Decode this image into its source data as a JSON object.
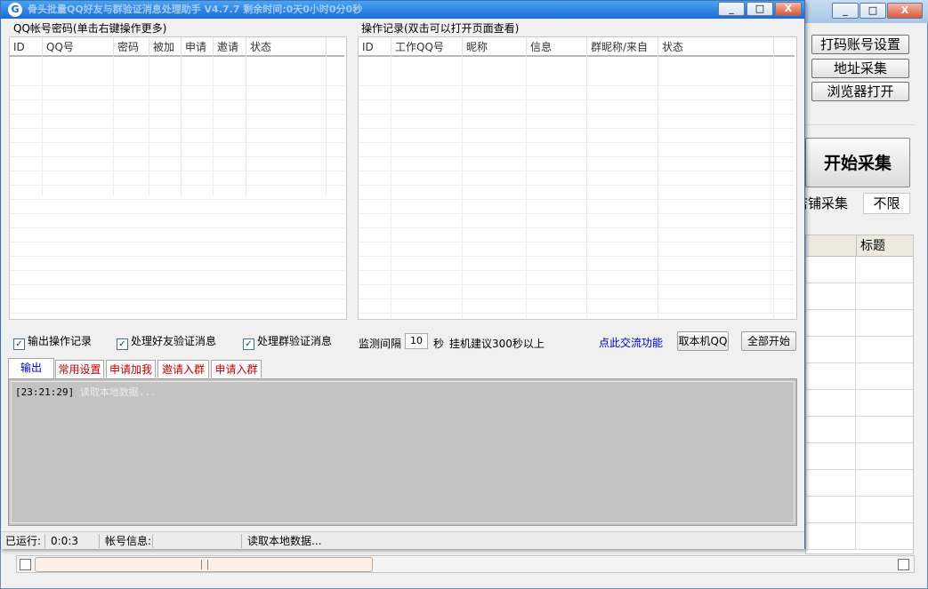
{
  "background_window": {
    "buttons": {
      "captcha_account_settings": "打码账号设置",
      "address_collect": "地址采集",
      "browser_open": "浏览器打开"
    },
    "start_collect": "开始采集",
    "store_collect_label": "店铺采集",
    "store_collect_value": "不限",
    "table": {
      "header_title": "标题"
    }
  },
  "window": {
    "title": "骨头批量QQ好友与群验证消息处理助手 V4.7.7 剩余时间:0天0小时0分0秒",
    "icon_letter": "G",
    "controls": {
      "minimize": "_",
      "maximize": "□",
      "close": "X"
    }
  },
  "accounts_panel": {
    "label": "QQ帐号密码(单击右键操作更多)",
    "columns": [
      "ID",
      "QQ号",
      "密码",
      "被加",
      "申请",
      "邀请",
      "状态"
    ]
  },
  "records_panel": {
    "label": "操作记录(双击可以打开页面查看)",
    "columns": [
      "ID",
      "工作QQ号",
      "昵称",
      "信息",
      "群昵称/来自",
      "状态"
    ]
  },
  "options": {
    "output_log": "输出操作记录",
    "handle_friend": "处理好友验证消息",
    "handle_group": "处理群验证消息",
    "interval_label": "监测间隔",
    "interval_value": "10",
    "interval_unit": "秒",
    "interval_hint": "挂机建议300秒以上",
    "exchange_link": "点此交流功能",
    "get_local_qq": "取本机QQ",
    "start_all": "全部开始"
  },
  "tabs": [
    "输出",
    "常用设置",
    "申请加我",
    "邀请入群",
    "申请入群"
  ],
  "log": {
    "time": "[23:21:29]",
    "message": "读取本地数据..."
  },
  "statusbar": {
    "running_label": "已运行:",
    "running_value": "0:0:3",
    "account_info_label": "帐号信息:",
    "message": "读取本地数据..."
  }
}
